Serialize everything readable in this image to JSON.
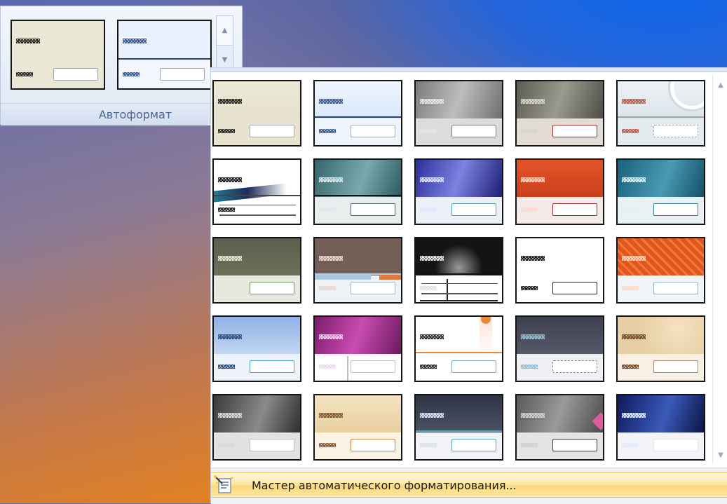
{
  "ribbon": {
    "label": "Автоформат",
    "scroll_up": "▲",
    "scroll_down": "▼",
    "thumbs": [
      {
        "hdr": "#ebe7d5",
        "ftr": "#ebe7d5",
        "hatch": "#2a2a2a",
        "field": "#9aa4b2",
        "line": ""
      },
      {
        "hdr": "#e8f1fd",
        "ftr": "#f3f7fd",
        "hatch": "#3b5a94",
        "field": "#9aa4b2",
        "line": "#2c4466"
      }
    ]
  },
  "gallery": {
    "scroll_up": "▲",
    "scroll_down": "▼",
    "footer_label": "Мастер автоматического форматирования...",
    "styles": [
      {
        "name": "style-1",
        "hdr": "linear-gradient(#ece8d6,#e6e1cc)",
        "ftr": "#e8e3cf",
        "hatch": "#2b2b2b",
        "field": "#a2aab6",
        "line": ""
      },
      {
        "name": "style-2",
        "hdr": "linear-gradient(#f0f6fe,#d9e7fa)",
        "ftr": "#eef4fc",
        "hatch": "#3d5c98",
        "field": "#a2aab6",
        "line": "#2b4466"
      },
      {
        "name": "style-3",
        "hdr": "linear-gradient(110deg,#7a7a7a,#bdbdbd 50%,#6f6f6f)",
        "ftr": "#dcdcdc",
        "hatch": "#e6e6e6",
        "field": "#7c7c7c",
        "line": ""
      },
      {
        "name": "style-4",
        "hdr": "linear-gradient(110deg,#5a5a50,#9b9a8e 50%,#4d4d45)",
        "ftr": "#e3dcd4",
        "hatch": "#d8d4c4",
        "field": "#9c2a2a",
        "line": ""
      },
      {
        "name": "style-5",
        "hdr": "linear-gradient(#edf2f6,#dbe4ea)",
        "ftr": "#e4ebef",
        "hatch": "#c55a4a",
        "field": "#9aa4b2",
        "line": "#95a9a6",
        "dashed": true,
        "circle": true
      },
      {
        "name": "style-6",
        "hdr": "#ffffff",
        "ftr": "#ffffff",
        "hatch": "#1f1f1f",
        "field": "",
        "line": "#444",
        "swoosh": true
      },
      {
        "name": "style-7",
        "hdr": "linear-gradient(110deg,#34656a,#7aa8ad 55%,#2d5b60)",
        "ftr": "#e8edee",
        "hatch": "#dfe8ea",
        "field": "#506068",
        "line": "#111111"
      },
      {
        "name": "style-8",
        "hdr": "linear-gradient(110deg,#2b2f9a,#7c82e0 50%,#1d1f76)",
        "ftr": "#eef0f8",
        "hatch": "#e2e4ff",
        "field": "#4a9ab6",
        "line": ""
      },
      {
        "name": "style-9",
        "hdr": "linear-gradient(#e4542a,#c8401a)",
        "ftr": "#f4ebe8",
        "hatch": "#ffd8c8",
        "field": "#9c2a2a",
        "line": ""
      },
      {
        "name": "style-10",
        "hdr": "linear-gradient(110deg,#19607c,#4a9ab3 55%,#154f68)",
        "ftr": "#e8f1f4",
        "hatch": "#dff1f6",
        "field": "#2f7e96",
        "line": ""
      },
      {
        "name": "style-11",
        "hdr": "linear-gradient(#5c5d4c,#6f705c)",
        "ftr": "#e7e8de",
        "hatch": "#e7e6d2",
        "field": "#6d9a5a",
        "line": ""
      },
      {
        "name": "style-12",
        "hdr": "#735e58",
        "ftr": "#eef2f6",
        "hatch": "#ead6c8",
        "field": "#9ab7cc",
        "line": "#b8cde0",
        "bars": true
      },
      {
        "name": "style-13",
        "hdr": "radial-gradient(circle at 50% 80%,#9a9a9a,#141414 45%)",
        "ftr": "#ffffff",
        "hatch": "#e2e2e2",
        "field": "",
        "line": "#111111",
        "grid": true
      },
      {
        "name": "style-14",
        "hdr": "#ffffff",
        "ftr": "#ffffff",
        "hatch": "#1f1f1f",
        "field": "#222222",
        "line": ""
      },
      {
        "name": "style-15",
        "hdr": "repeating-linear-gradient(45deg,#e2561e 0 6px,#f07a3c 6px 9px)",
        "ftr": "#f1f4f8",
        "hatch": "#ffd8c2",
        "field": "#8fb2cc",
        "line": ""
      },
      {
        "name": "style-16",
        "hdr": "linear-gradient(#8fb2e6,#c2d6f2)",
        "ftr": "#eef3f9",
        "hatch": "#2e4f86",
        "field": "#4aa2c2",
        "line": ""
      },
      {
        "name": "style-17",
        "hdr": "linear-gradient(110deg,#7c1c6c,#c84cb2 50%,#6b1a5e)",
        "ftr": "#ffffff",
        "hatch": "#f0d6ee",
        "field": "#bdbdbd",
        "line": "",
        "split": true
      },
      {
        "name": "style-18",
        "hdr": "#ffffff",
        "ftr": "#ffffff",
        "hatch": "#2c2c2c",
        "field": "#7aa8c8",
        "line": "#e8883c",
        "sun": true
      },
      {
        "name": "style-19",
        "hdr": "linear-gradient(#3e4050,#555868)",
        "ftr": "#eef0f3",
        "hatch": "#8ec1d6",
        "field": "#7b8596",
        "line": "",
        "dashed": true
      },
      {
        "name": "style-20",
        "hdr": "radial-gradient(circle at 70% 30%,#f6e2c2,#e6cfa4 60%)",
        "ftr": "#f8f0e4",
        "hatch": "#7a4b2b",
        "field": "#a08a72",
        "line": ""
      },
      {
        "name": "style-21",
        "hdr": "linear-gradient(110deg,#3a3a3a,#8a8a8a 55%,#2e2e2e)",
        "ftr": "#e2e2e2",
        "hatch": "#d8d8d8",
        "field": "#bdbdbd",
        "line": ""
      },
      {
        "name": "style-22",
        "hdr": "linear-gradient(#f4e3c2,#e8cfa0)",
        "ftr": "#fbf4e6",
        "hatch": "#8a5a36",
        "field": "#c8843a",
        "line": ""
      },
      {
        "name": "style-23",
        "hdr": "linear-gradient(#2e3444,#4a5266)",
        "ftr": "#f1f3f6",
        "hatch": "#d8e0ec",
        "field": "#5aa2b6",
        "line": "#5aa6b6"
      },
      {
        "name": "style-24",
        "hdr": "linear-gradient(110deg,#5a5a5a,#9a9a9a 50%,#4a4a4a)",
        "ftr": "#e4e4e4",
        "hatch": "#d0d0d0",
        "field": "#3a3a3a",
        "line": "",
        "pink": true
      },
      {
        "name": "style-25",
        "hdr": "linear-gradient(110deg,#0e1a5c,#3b5ab8 55%,#0b1446)",
        "ftr": "#f2f4f8",
        "hatch": "#e2e8ff",
        "field": "#e6e6e6",
        "line": ""
      }
    ]
  }
}
